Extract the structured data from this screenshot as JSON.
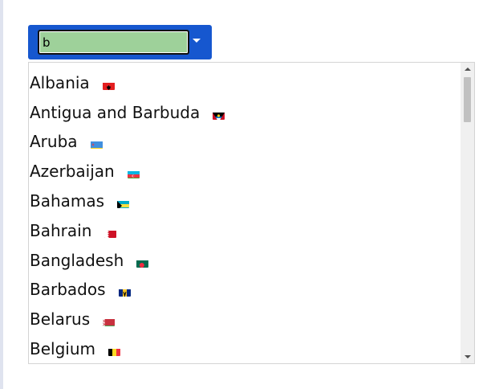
{
  "combobox": {
    "value": "b",
    "accent_color": "#1657cf",
    "input_bg": "#9ed19a",
    "arrow_icon": "caret-down-icon"
  },
  "dropdown": {
    "options": [
      {
        "label": "Albania",
        "flag": "flag-albania"
      },
      {
        "label": "Antigua and Barbuda",
        "flag": "flag-antigua-and-barbuda"
      },
      {
        "label": "Aruba",
        "flag": "flag-aruba"
      },
      {
        "label": "Azerbaijan",
        "flag": "flag-azerbaijan"
      },
      {
        "label": "Bahamas",
        "flag": "flag-bahamas"
      },
      {
        "label": "Bahrain",
        "flag": "flag-bahrain"
      },
      {
        "label": "Bangladesh",
        "flag": "flag-bangladesh"
      },
      {
        "label": "Barbados",
        "flag": "flag-barbados"
      },
      {
        "label": "Belarus",
        "flag": "flag-belarus"
      },
      {
        "label": "Belgium",
        "flag": "flag-belgium"
      }
    ]
  },
  "scrollbar": {
    "scroll_position": 0.0
  }
}
